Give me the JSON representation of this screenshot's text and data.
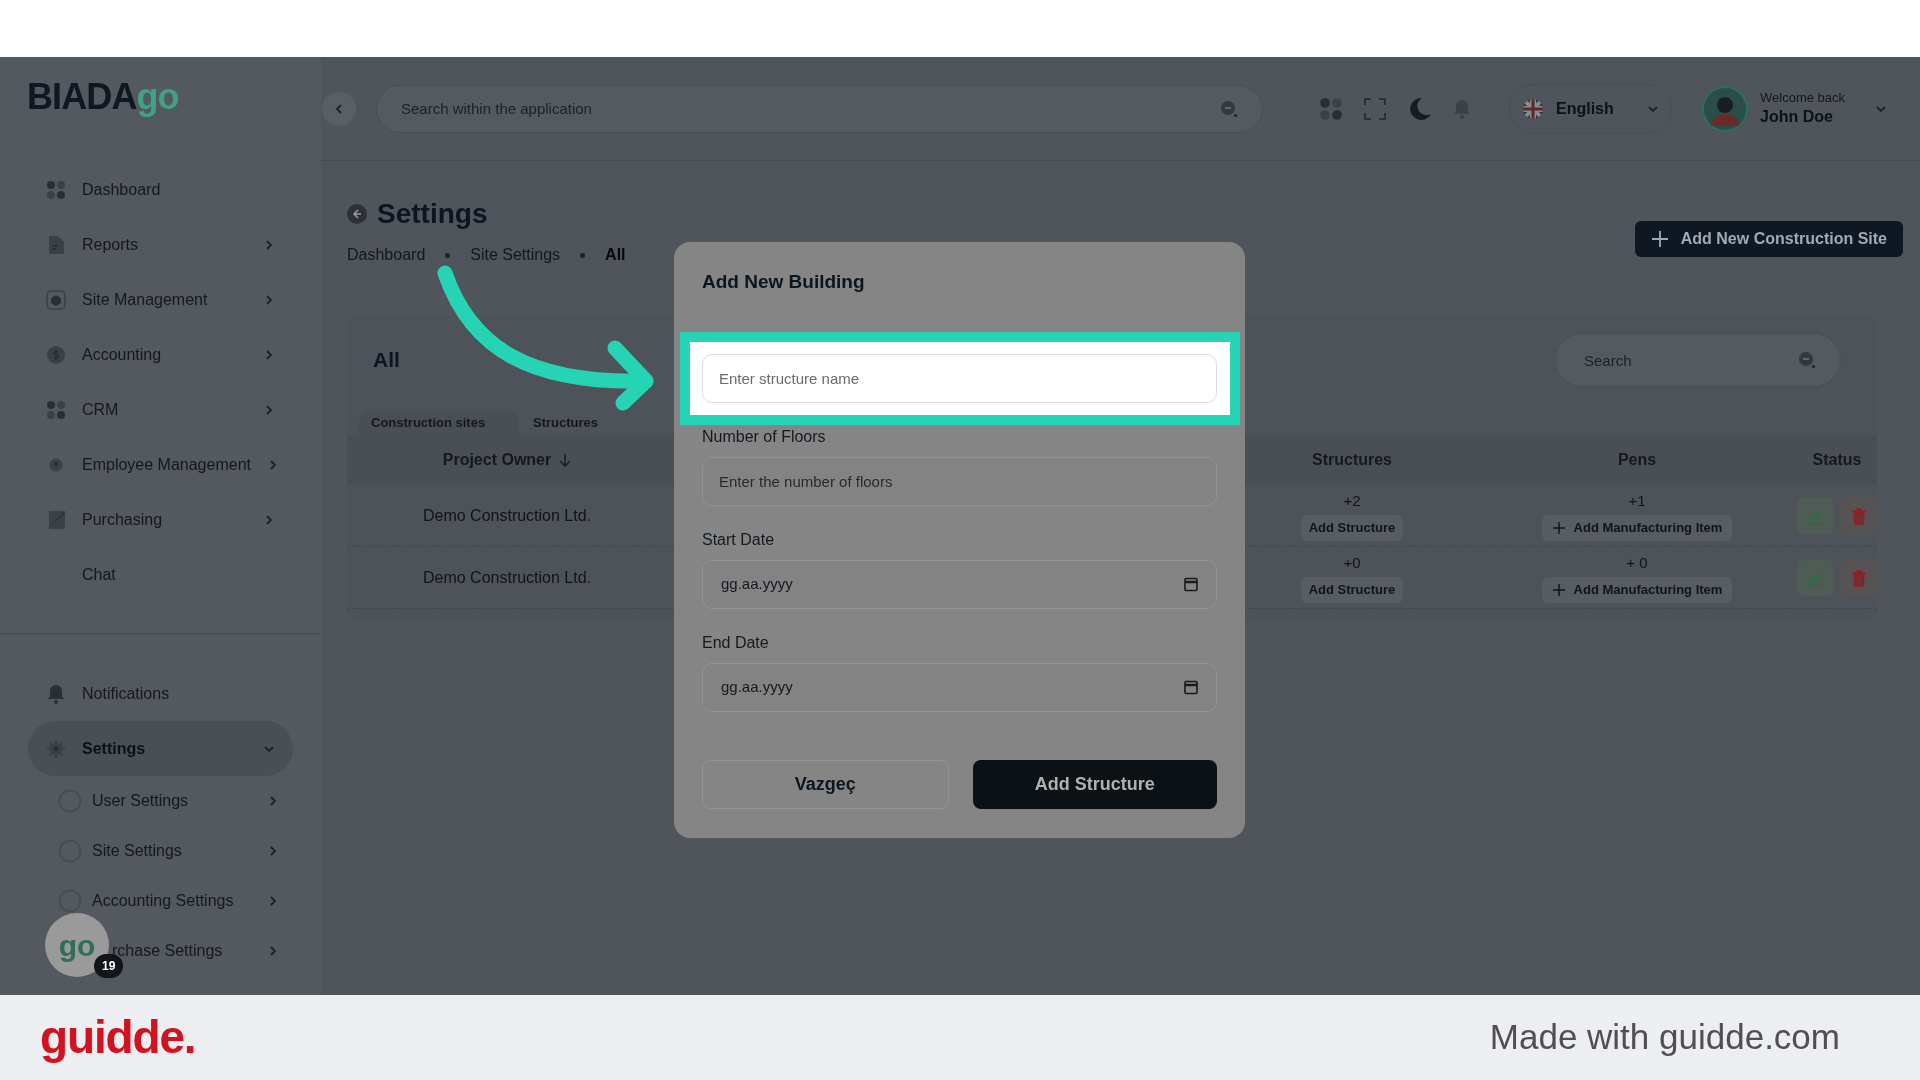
{
  "top_bar": {
    "logo": {
      "text": "BIADA",
      "accent": "go"
    },
    "search": {
      "placeholder": "Search within the application"
    },
    "language": "English",
    "user": {
      "greeting": "Welcome back",
      "name": "John Doe"
    }
  },
  "sidebar": {
    "items": [
      {
        "label": "Dashboard",
        "kind": "link",
        "selected": false
      },
      {
        "label": "Reports",
        "kind": "group",
        "expanded": false,
        "selected": false
      },
      {
        "label": "Site Management",
        "kind": "group",
        "expanded": false,
        "selected": false
      },
      {
        "label": "Accounting",
        "kind": "group",
        "expanded": false,
        "selected": false
      },
      {
        "label": "CRM",
        "kind": "group",
        "expanded": false,
        "selected": false
      },
      {
        "label": "Employee Management",
        "kind": "group",
        "expanded": false,
        "selected": false
      },
      {
        "label": "Purchasing",
        "kind": "group",
        "expanded": false,
        "selected": false
      },
      {
        "label": "Chat",
        "kind": "link",
        "selected": false
      }
    ],
    "bottom_items": [
      {
        "label": "Notifications",
        "kind": "link",
        "selected": false
      },
      {
        "label": "Settings",
        "kind": "group",
        "expanded": true,
        "selected": true,
        "children": [
          {
            "label": "User Settings",
            "selected": false
          },
          {
            "label": "Site Settings",
            "selected": false
          },
          {
            "label": "Accounting Settings",
            "selected": false
          },
          {
            "label": "rchase Settings",
            "selected": false
          }
        ]
      }
    ]
  },
  "chat_widget": {
    "text": "go",
    "badge": "19"
  },
  "page": {
    "title": "Settings",
    "breadcrumbs": [
      {
        "label": "Dashboard",
        "current": false
      },
      {
        "label": "Site Settings",
        "current": false
      },
      {
        "label": "All",
        "current": true
      }
    ],
    "action_button": "Add New Construction Site",
    "card": {
      "title": "All",
      "search": {
        "placeholder": "Search"
      },
      "tabs": [
        {
          "label": "Construction sites",
          "selected": true
        },
        {
          "label": "Structures",
          "selected": false
        }
      ],
      "columns": [
        {
          "label": "Project Owner",
          "sorted": true
        },
        {
          "label": "Structures",
          "sorted": false
        },
        {
          "label": "Pens",
          "sorted": false
        },
        {
          "label": "Status",
          "sorted": false
        }
      ],
      "rows": [
        {
          "owner": "Demo Construction Ltd.",
          "structures": "+2",
          "structures_action": "Add Structure",
          "pens": "+1",
          "pens_action": "Add Manufacturing Item"
        },
        {
          "owner": "Demo Construction Ltd.",
          "structures": "+0",
          "structures_action": "Add Structure",
          "pens": "+ 0",
          "pens_action": "Add Manufacturing Item"
        }
      ]
    }
  },
  "modal": {
    "title": "Add New Building",
    "fields": [
      {
        "kind": "text",
        "placeholder": "Enter structure name",
        "focused": true
      },
      {
        "kind": "text",
        "label": "Number of Floors",
        "placeholder": "Enter the number of floors",
        "focused": false
      },
      {
        "kind": "date",
        "label": "Start Date",
        "value": "gg.aa.yyyy",
        "focused": false
      },
      {
        "kind": "date",
        "label": "End Date",
        "value": "gg.aa.yyyy",
        "focused": false
      }
    ],
    "buttons": [
      {
        "label": "Vazgeç",
        "kind": "secondary"
      },
      {
        "label": "Add Structure",
        "kind": "primary"
      }
    ]
  },
  "footer": {
    "brand": "guidde.",
    "tagline": "Made with guidde.com"
  }
}
